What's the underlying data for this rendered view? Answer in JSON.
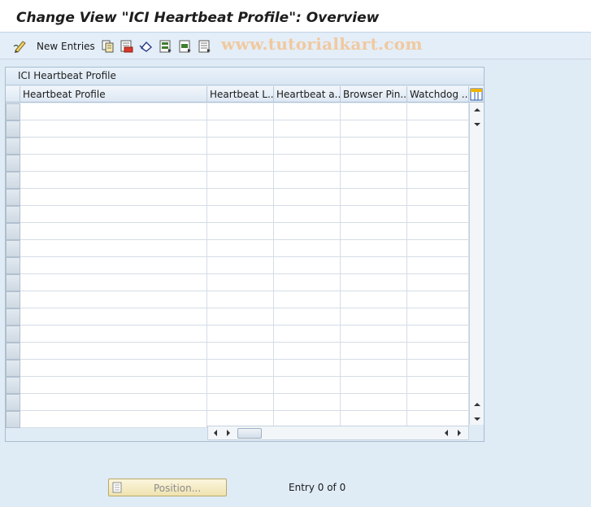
{
  "window": {
    "title": "Change View \"ICI Heartbeat Profile\": Overview"
  },
  "toolbar": {
    "new_entries_label": "New Entries",
    "watermark": "www.tutorialkart.com",
    "icons": [
      "edit-icon",
      "copy-icon",
      "delete-icon",
      "undo-icon",
      "select-all-icon",
      "select-block-icon",
      "deselect-all-icon"
    ]
  },
  "table": {
    "title": "ICI Heartbeat Profile",
    "columns": [
      "Heartbeat Profile",
      "Heartbeat L...",
      "Heartbeat a...",
      "Browser Pin...",
      "Watchdog ..."
    ],
    "rows": [
      [
        "",
        "",
        "",
        "",
        ""
      ],
      [
        "",
        "",
        "",
        "",
        ""
      ],
      [
        "",
        "",
        "",
        "",
        ""
      ],
      [
        "",
        "",
        "",
        "",
        ""
      ],
      [
        "",
        "",
        "",
        "",
        ""
      ],
      [
        "",
        "",
        "",
        "",
        ""
      ],
      [
        "",
        "",
        "",
        "",
        ""
      ],
      [
        "",
        "",
        "",
        "",
        ""
      ],
      [
        "",
        "",
        "",
        "",
        ""
      ],
      [
        "",
        "",
        "",
        "",
        ""
      ],
      [
        "",
        "",
        "",
        "",
        ""
      ],
      [
        "",
        "",
        "",
        "",
        ""
      ],
      [
        "",
        "",
        "",
        "",
        ""
      ],
      [
        "",
        "",
        "",
        "",
        ""
      ],
      [
        "",
        "",
        "",
        "",
        ""
      ],
      [
        "",
        "",
        "",
        "",
        ""
      ],
      [
        "",
        "",
        "",
        "",
        ""
      ],
      [
        "",
        "",
        "",
        "",
        ""
      ],
      [
        "",
        "",
        "",
        "",
        ""
      ]
    ]
  },
  "footer": {
    "position_label": "Position...",
    "entry_text": "Entry 0 of 0"
  }
}
